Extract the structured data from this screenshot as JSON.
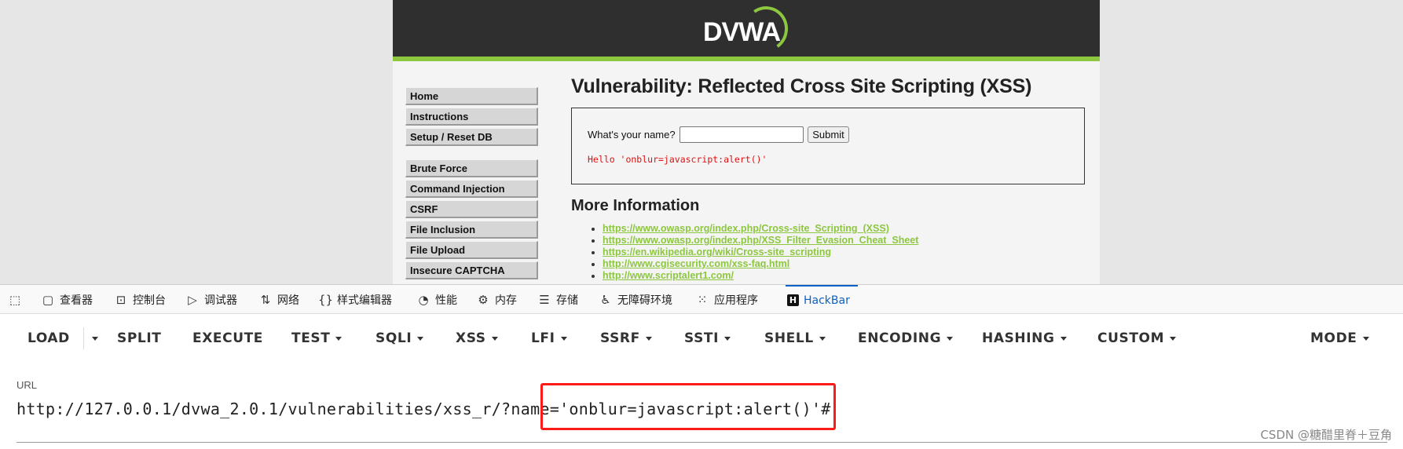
{
  "dvwa": {
    "logo_text": "DVWA",
    "menu": [
      "Home",
      "Instructions",
      "Setup / Reset DB",
      "Brute Force",
      "Command Injection",
      "CSRF",
      "File Inclusion",
      "File Upload",
      "Insecure CAPTCHA"
    ],
    "title": "Vulnerability: Reflected Cross Site Scripting (XSS)",
    "form": {
      "label": "What's your name?",
      "input_value": "",
      "submit_label": "Submit"
    },
    "hello_message": "Hello 'onblur=javascript:alert()'",
    "more_info_title": "More Information",
    "links": [
      "https://www.owasp.org/index.php/Cross-site_Scripting_(XSS)",
      "https://www.owasp.org/index.php/XSS_Filter_Evasion_Cheat_Sheet",
      "https://en.wikipedia.org/wiki/Cross-site_scripting",
      "http://www.cgisecurity.com/xss-faq.html",
      "http://www.scriptalert1.com/"
    ]
  },
  "devtools": {
    "tabs": [
      {
        "label": "查看器",
        "icon": "inspector-icon"
      },
      {
        "label": "控制台",
        "icon": "console-icon"
      },
      {
        "label": "调试器",
        "icon": "debugger-icon"
      },
      {
        "label": "网络",
        "icon": "network-icon"
      },
      {
        "label": "样式编辑器",
        "icon": "style-editor-icon"
      },
      {
        "label": "性能",
        "icon": "performance-icon"
      },
      {
        "label": "内存",
        "icon": "memory-icon"
      },
      {
        "label": "存储",
        "icon": "storage-icon"
      },
      {
        "label": "无障碍环境",
        "icon": "accessibility-icon"
      },
      {
        "label": "应用程序",
        "icon": "application-icon"
      },
      {
        "label": "HackBar",
        "icon": "hackbar-icon",
        "active": true
      }
    ]
  },
  "hackbar": {
    "buttons": [
      "LOAD",
      "SPLIT",
      "EXECUTE",
      "TEST",
      "SQLI",
      "XSS",
      "LFI",
      "SSRF",
      "SSTI",
      "SHELL",
      "ENCODING",
      "HASHING",
      "CUSTOM",
      "MODE"
    ],
    "url_label": "URL",
    "url_value": "http://127.0.0.1/dvwa_2.0.1/vulnerabilities/xss_r/?name='onblur=javascript:alert()'#"
  },
  "watermark": "CSDN @糖醋里脊＋豆角",
  "colors": {
    "accent_green": "#8dc63f",
    "hackbar_active": "#0a62c9",
    "highlight_red": "#ff1a1a",
    "hello_red": "#e01010"
  }
}
